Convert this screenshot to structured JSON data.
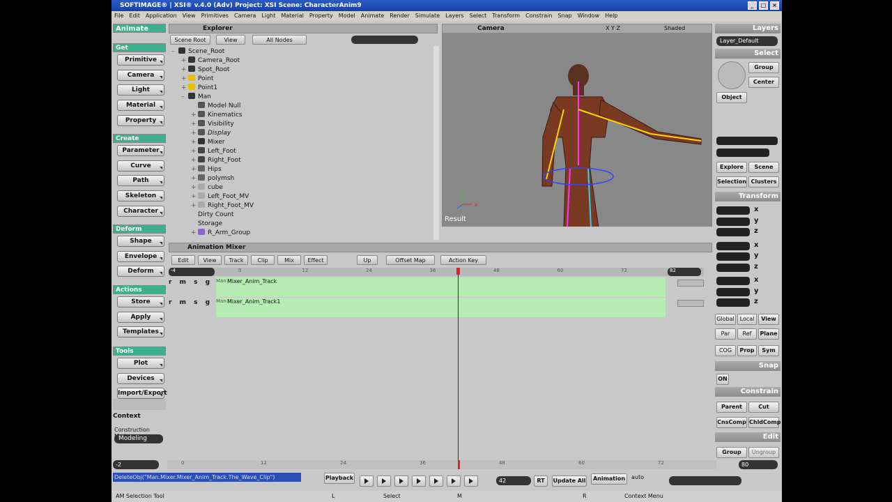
{
  "window": {
    "title": "SOFTIMAGE® | XSI® v.4.0 (Adv) Project: XSI    Scene: CharacterAnim9"
  },
  "menu": [
    "File",
    "Edit",
    "Application",
    "View",
    "Primitives",
    "Camera",
    "Light",
    "Material",
    "Property",
    "Model",
    "Animate",
    "Render",
    "Simulate",
    "Layers",
    "Select",
    "Transform",
    "Constrain",
    "Snap",
    "Window",
    "Help"
  ],
  "left": {
    "module": "Animate",
    "sections": {
      "get": "Get",
      "create": "Create",
      "deform": "Deform",
      "actions": "Actions",
      "tools": "Tools"
    },
    "get_buttons": [
      "Primitive",
      "Camera",
      "Light",
      "Material",
      "Property"
    ],
    "create_buttons": [
      "Parameter",
      "Curve",
      "Path",
      "Skeleton",
      "Character"
    ],
    "deform_buttons": [
      "Shape",
      "Envelope",
      "Deform"
    ],
    "actions_buttons": [
      "Store",
      "Apply",
      "Templates"
    ],
    "tools_buttons": [
      "Plot",
      "Devices",
      "Import/Export"
    ],
    "context": "Context",
    "construction_mode_label": "Construction Mode",
    "construction_mode_value": "Modeling"
  },
  "explorer": {
    "title": "Explorer",
    "scope": "Scene Root",
    "view": "View",
    "filter": "All Nodes",
    "tree": [
      "Scene_Root",
      "Camera_Root",
      "Spot_Root",
      "Point",
      "Point1",
      "Man",
      "Model Null",
      "Kinematics",
      "Visibility",
      "Display",
      "Mixer",
      "Left_Foot",
      "Right_Foot",
      "Hips",
      "polymsh",
      "cube",
      "Left_Foot_MV",
      "Right_Foot_MV",
      "Dirty Count",
      "Storage",
      "R_Arm_Group"
    ]
  },
  "viewport": {
    "camera": "Camera",
    "mode": "Shaded",
    "axes": "X Y Z",
    "label": "Result",
    "axis_x": "x",
    "axis_y": "y"
  },
  "right": {
    "layers": "Layers",
    "layer_default": "Layer_Default",
    "select": "Select",
    "group": "Group",
    "center": "Center",
    "object": "Object",
    "explore": "Explore",
    "scene": "Scene",
    "selection": "Selection",
    "clusters": "Clusters",
    "transform": "Transform",
    "x": "x",
    "y": "y",
    "z": "z",
    "global": "Global",
    "local": "Local",
    "view": "View",
    "par": "Par",
    "ref": "Ref",
    "plane": "Plane",
    "cog": "COG",
    "prop": "Prop",
    "sym": "Sym",
    "snap": "Snap",
    "on": "ON",
    "constrain": "Constrain",
    "parent": "Parent",
    "cut": "Cut",
    "cnscomp": "CnsComp",
    "chldcomp": "ChldComp",
    "edit": "Edit",
    "ugroup": "Ungroup"
  },
  "mixer": {
    "title": "Animation Mixer",
    "menus": [
      "Edit",
      "View",
      "Track",
      "Clip",
      "Mix",
      "Effect"
    ],
    "up": "Up",
    "offset_map": "Offset Map",
    "action_key": "Action Key",
    "start": "-4",
    "end": "82",
    "ticks": [
      "0",
      "12",
      "24",
      "36",
      "48",
      "60",
      "72"
    ],
    "tracks": [
      {
        "prefix": "Man",
        "name": "Mixer_Anim_Track"
      },
      {
        "prefix": "Man",
        "name": "Mixer_Anim_Track1"
      }
    ],
    "track_flags": "r m s g"
  },
  "timeline": {
    "start": "-2",
    "end": "80",
    "ticks": [
      "0",
      "12",
      "24",
      "36",
      "48",
      "60",
      "72"
    ],
    "command": "DeleteObj(\"Man.Mixer.Mixer_Anim_Track.The_Wave_Clip\")",
    "playback": "Playback",
    "frame": "42",
    "rt": "RT",
    "update_all": "Update All",
    "animation": "Animation",
    "auto": "auto"
  },
  "status": {
    "tool": "AM Selection Tool",
    "left_hint": "Select",
    "right_hint": "Context Menu",
    "l": "L",
    "m": "M",
    "r": "R"
  }
}
